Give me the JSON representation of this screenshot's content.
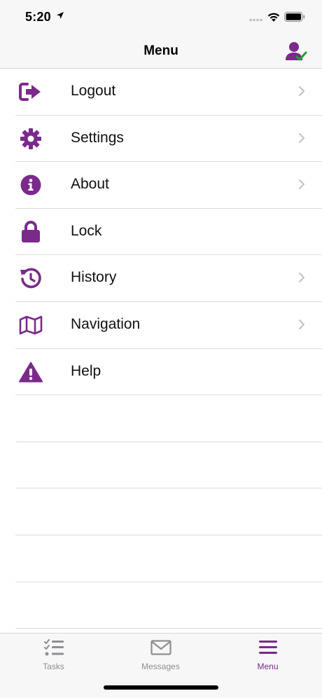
{
  "status_bar": {
    "time": "5:20"
  },
  "nav": {
    "title": "Menu"
  },
  "colors": {
    "accent": "#7b2a8b",
    "check": "#1fa02f",
    "inactive": "#8e8e93"
  },
  "menu_items": [
    {
      "label": "Logout",
      "icon": "logout-icon",
      "chevron": true
    },
    {
      "label": "Settings",
      "icon": "gear-icon",
      "chevron": true
    },
    {
      "label": "About",
      "icon": "info-icon",
      "chevron": true
    },
    {
      "label": "Lock",
      "icon": "lock-icon",
      "chevron": false
    },
    {
      "label": "History",
      "icon": "history-icon",
      "chevron": true
    },
    {
      "label": "Navigation",
      "icon": "map-icon",
      "chevron": true
    },
    {
      "label": "Help",
      "icon": "warning-icon",
      "chevron": false
    }
  ],
  "tabs": [
    {
      "label": "Tasks",
      "icon": "tasks-icon",
      "active": false
    },
    {
      "label": "Messages",
      "icon": "envelope-icon",
      "active": false
    },
    {
      "label": "Menu",
      "icon": "hamburger-icon",
      "active": true
    }
  ]
}
